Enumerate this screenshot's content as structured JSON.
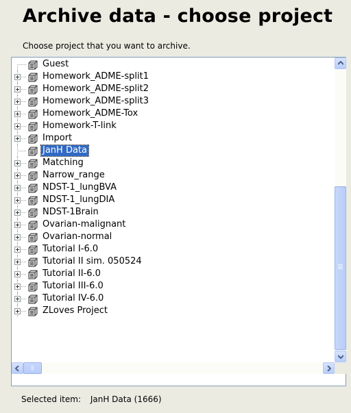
{
  "header": {
    "title": "Archive data - choose project",
    "subtitle": "Choose project that you want to archive."
  },
  "tree": {
    "items": [
      {
        "label": "Guest",
        "expandable": false,
        "selected": false
      },
      {
        "label": "Homework_ADME-split1",
        "expandable": true,
        "selected": false
      },
      {
        "label": "Homework_ADME-split2",
        "expandable": true,
        "selected": false
      },
      {
        "label": "Homework_ADME-split3",
        "expandable": true,
        "selected": false
      },
      {
        "label": "Homework_ADME-Tox",
        "expandable": true,
        "selected": false
      },
      {
        "label": "Homework-T-link",
        "expandable": true,
        "selected": false
      },
      {
        "label": "Import",
        "expandable": true,
        "selected": false
      },
      {
        "label": "JanH Data",
        "expandable": false,
        "selected": true
      },
      {
        "label": "Matching",
        "expandable": true,
        "selected": false
      },
      {
        "label": "Narrow_range",
        "expandable": true,
        "selected": false
      },
      {
        "label": "NDST-1_lungBVA",
        "expandable": true,
        "selected": false
      },
      {
        "label": "NDST-1_lungDIA",
        "expandable": true,
        "selected": false
      },
      {
        "label": "NDST-1Brain",
        "expandable": true,
        "selected": false
      },
      {
        "label": "Ovarian-malignant",
        "expandable": true,
        "selected": false
      },
      {
        "label": "Ovarian-normal",
        "expandable": true,
        "selected": false
      },
      {
        "label": "Tutorial I-6.0",
        "expandable": true,
        "selected": false
      },
      {
        "label": "Tutorial II sim. 050524",
        "expandable": true,
        "selected": false
      },
      {
        "label": "Tutorial II-6.0",
        "expandable": true,
        "selected": false
      },
      {
        "label": "Tutorial III-6.0",
        "expandable": true,
        "selected": false
      },
      {
        "label": "Tutorial IV-6.0",
        "expandable": true,
        "selected": false
      },
      {
        "label": "ZLoves Project",
        "expandable": true,
        "selected": false
      }
    ],
    "icon": "database-icon",
    "vertical_scroll_position": 0.45,
    "horizontal_scroll_position": 0.0
  },
  "status": {
    "label": "Selected item:",
    "value": "JanH Data (1666)"
  },
  "colors": {
    "background": "#ecebe2",
    "selection": "#316ac5",
    "scrollbar": "#c1d3fb"
  }
}
